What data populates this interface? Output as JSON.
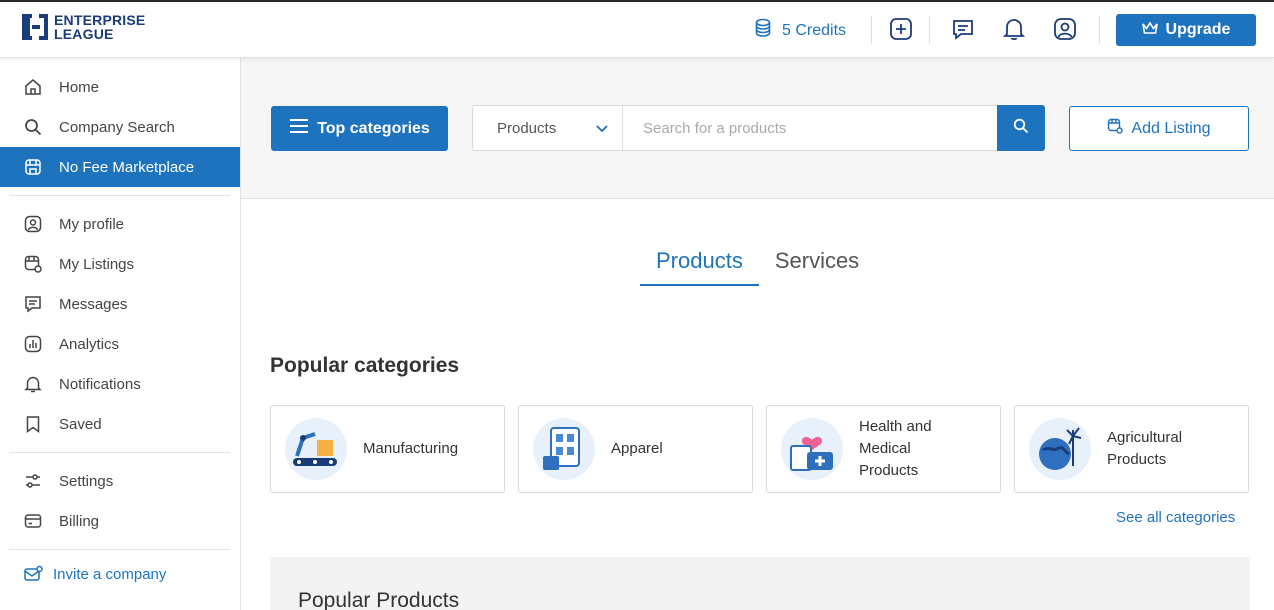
{
  "logo": {
    "line1": "ENTERPRISE",
    "line2": "LEAGUE"
  },
  "header": {
    "credits": "5 Credits",
    "upgrade": "Upgrade",
    "icons": [
      "coins-icon",
      "plus-square-icon",
      "chat-icon",
      "bell-icon",
      "user-icon"
    ]
  },
  "sidebar": {
    "items": [
      {
        "label": "Home",
        "icon": "home-icon"
      },
      {
        "label": "Company Search",
        "icon": "search-icon"
      },
      {
        "label": "No Fee Marketplace",
        "icon": "store-icon",
        "active": true
      },
      {
        "label": "My profile",
        "icon": "profile-icon"
      },
      {
        "label": "My Listings",
        "icon": "listings-icon"
      },
      {
        "label": "Messages",
        "icon": "message-icon"
      },
      {
        "label": "Analytics",
        "icon": "analytics-icon"
      },
      {
        "label": "Notifications",
        "icon": "bell-icon"
      },
      {
        "label": "Saved",
        "icon": "bookmark-icon"
      },
      {
        "label": "Settings",
        "icon": "sliders-icon"
      },
      {
        "label": "Billing",
        "icon": "card-icon"
      }
    ],
    "invite": "Invite a company"
  },
  "search": {
    "top_categories": "Top categories",
    "select_value": "Products",
    "placeholder": "Search for a products",
    "add_listing": "Add Listing"
  },
  "tabs": {
    "products": "Products",
    "services": "Services"
  },
  "popular": {
    "title": "Popular categories",
    "categories": [
      {
        "label": "Manufacturing"
      },
      {
        "label": "Apparel"
      },
      {
        "label": "Health and Medical Products"
      },
      {
        "label": "Agricultural Products"
      }
    ],
    "see_all": "See all categories"
  },
  "popular_products": {
    "title": "Popular Products"
  },
  "colors": {
    "primary": "#1e73be",
    "logo": "#1a3d7a"
  }
}
